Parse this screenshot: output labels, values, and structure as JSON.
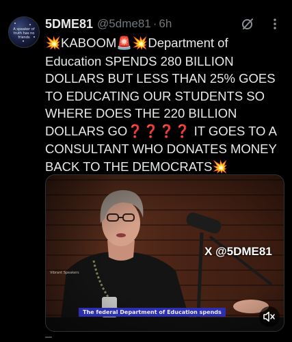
{
  "post": {
    "avatar_text": "A speaker of truth has no friends",
    "display_name": "5DME81",
    "handle": "@5dme81",
    "separator": "·",
    "timestamp": "6h",
    "lines": [
      {
        "e1": "💥",
        "t1": "KABOOM",
        "e2": "🚨",
        "e3": "💥",
        "t2": "Department of"
      },
      {
        "t": "Education SPENDS 280 BILLION"
      },
      {
        "t": "DOLLARS BUT LESS THAN 25% GOES"
      },
      {
        "t": "TO EDUCATING OUR STUDENTS SO"
      },
      {
        "t": "WHERE DOES THE 220 BILLION"
      },
      {
        "t1": "DOLLARS GO",
        "q": "❓❓❓❓",
        "t2": " IT GOES TO A"
      },
      {
        "t": "CONSULTANT WHO DONATES MONEY"
      },
      {
        "t": "BACK TO THE DEMOCRATS",
        "e": "💥"
      }
    ]
  },
  "media": {
    "watermark": "X @5DME81",
    "caption": "The federal Department of Education spends",
    "speaker_lower_third": "Vibrant Speakers"
  },
  "icons": {
    "grok": "grok-icon",
    "more": "more-options-icon",
    "mute": "volume-muted-icon"
  }
}
